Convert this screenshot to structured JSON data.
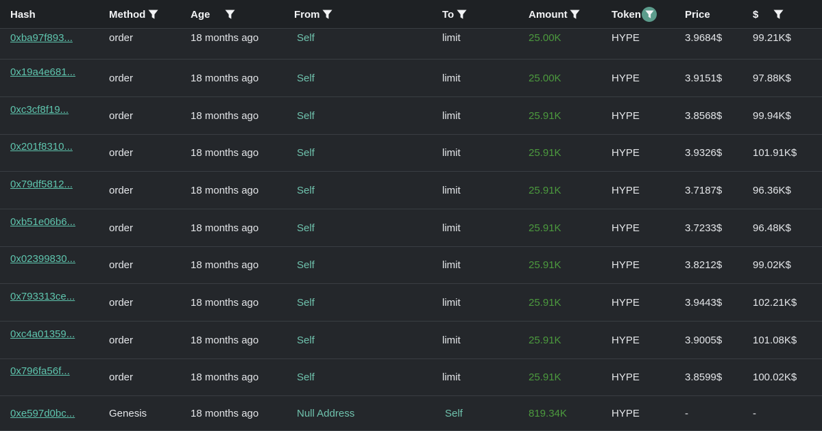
{
  "columns": {
    "hash": "Hash",
    "method": "Method",
    "age": "Age",
    "from": "From",
    "to": "To",
    "amount": "Amount",
    "token": "Token",
    "price": "Price",
    "usd": "$"
  },
  "icons": {
    "filter": "filter-icon"
  },
  "colors": {
    "link": "#5ec4ad",
    "amount": "#4c9a3e",
    "active_filter": "#5c9c8c"
  },
  "rows": [
    {
      "hash": "0xba97f893...",
      "method": "order",
      "age": "18 months ago",
      "from": "Self",
      "to": "limit",
      "amount": "25.00K",
      "token": "HYPE",
      "price": "3.9684$",
      "usd": "99.21K$"
    },
    {
      "hash": "0x19a4e681...",
      "method": "order",
      "age": "18 months ago",
      "from": "Self",
      "to": "limit",
      "amount": "25.00K",
      "token": "HYPE",
      "price": "3.9151$",
      "usd": "97.88K$"
    },
    {
      "hash": "0xc3cf8f19...",
      "method": "order",
      "age": "18 months ago",
      "from": "Self",
      "to": "limit",
      "amount": "25.91K",
      "token": "HYPE",
      "price": "3.8568$",
      "usd": "99.94K$"
    },
    {
      "hash": "0x201f8310...",
      "method": "order",
      "age": "18 months ago",
      "from": "Self",
      "to": "limit",
      "amount": "25.91K",
      "token": "HYPE",
      "price": "3.9326$",
      "usd": "101.91K$"
    },
    {
      "hash": "0x79df5812...",
      "method": "order",
      "age": "18 months ago",
      "from": "Self",
      "to": "limit",
      "amount": "25.91K",
      "token": "HYPE",
      "price": "3.7187$",
      "usd": "96.36K$"
    },
    {
      "hash": "0xb51e06b6...",
      "method": "order",
      "age": "18 months ago",
      "from": "Self",
      "to": "limit",
      "amount": "25.91K",
      "token": "HYPE",
      "price": "3.7233$",
      "usd": "96.48K$"
    },
    {
      "hash": "0x02399830...",
      "method": "order",
      "age": "18 months ago",
      "from": "Self",
      "to": "limit",
      "amount": "25.91K",
      "token": "HYPE",
      "price": "3.8212$",
      "usd": "99.02K$"
    },
    {
      "hash": "0x793313ce...",
      "method": "order",
      "age": "18 months ago",
      "from": "Self",
      "to": "limit",
      "amount": "25.91K",
      "token": "HYPE",
      "price": "3.9443$",
      "usd": "102.21K$"
    },
    {
      "hash": "0xc4a01359...",
      "method": "order",
      "age": "18 months ago",
      "from": "Self",
      "to": "limit",
      "amount": "25.91K",
      "token": "HYPE",
      "price": "3.9005$",
      "usd": "101.08K$"
    },
    {
      "hash": "0x796fa56f...",
      "method": "order",
      "age": "18 months ago",
      "from": "Self",
      "to": "limit",
      "amount": "25.91K",
      "token": "HYPE",
      "price": "3.8599$",
      "usd": "100.02K$"
    },
    {
      "hash": "0xe597d0bc...",
      "method": "Genesis",
      "age": "18 months ago",
      "from": "Null Address",
      "to": "Self",
      "amount": "819.34K",
      "token": "HYPE",
      "price": "-",
      "usd": "-"
    }
  ]
}
